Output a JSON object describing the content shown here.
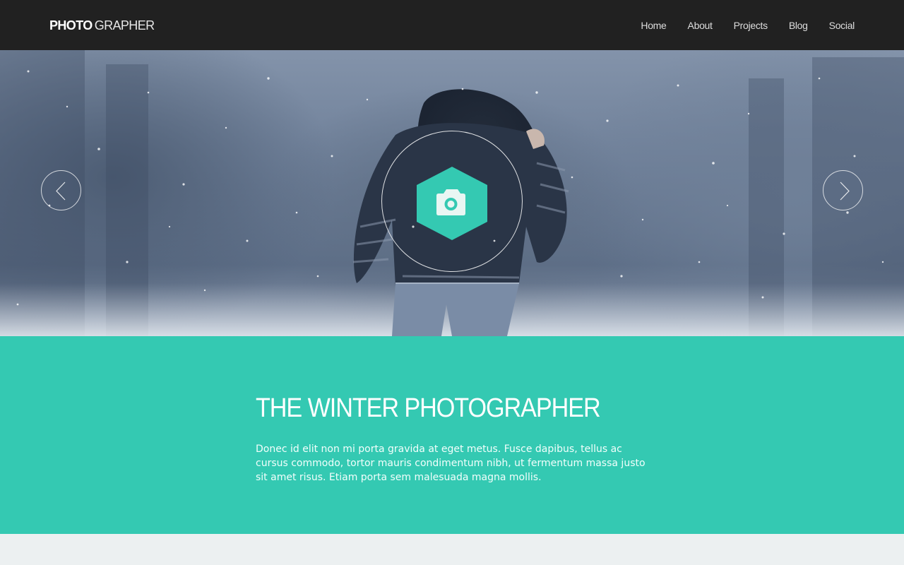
{
  "navbar": {
    "brand_bold": "PHOTO",
    "brand_light": "GRAPHER",
    "links": [
      {
        "label": "Home"
      },
      {
        "label": "About"
      },
      {
        "label": "Projects"
      },
      {
        "label": "Blog"
      },
      {
        "label": "Social"
      }
    ],
    "background": "#212121"
  },
  "hero": {
    "badge_icon": "camera-icon",
    "badge_color": "#34c9b2",
    "prev_icon": "chevron-left-icon",
    "next_icon": "chevron-right-icon"
  },
  "feature": {
    "title": "THE WINTER PHOTOGRAPHER",
    "text": "Donec id elit non mi porta gravida at eget metus. Fusce dapibus, tellus ac cursus commodo, tortor mauris condimentum nibh, ut fermentum massa justo sit amet risus. Etiam porta sem malesuada magna mollis.",
    "background": "#34c9b2"
  }
}
